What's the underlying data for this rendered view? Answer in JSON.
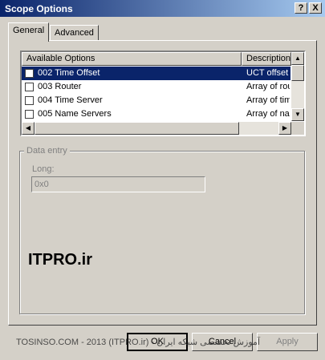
{
  "window": {
    "title": "Scope Options",
    "help_label": "?",
    "close_label": "X"
  },
  "tabs": [
    {
      "label": "General",
      "active": true
    },
    {
      "label": "Advanced",
      "active": false
    }
  ],
  "list": {
    "columns": [
      "Available Options",
      "Description"
    ],
    "rows": [
      {
        "name": "002 Time Offset",
        "desc": "UCT offset in",
        "selected": true
      },
      {
        "name": "003 Router",
        "desc": "Array of rout",
        "selected": false
      },
      {
        "name": "004 Time Server",
        "desc": "Array of time",
        "selected": false
      },
      {
        "name": "005 Name Servers",
        "desc": "Array of nam",
        "selected": false
      }
    ]
  },
  "data_entry": {
    "group_label": "Data entry",
    "long_label": "Long:",
    "long_value": "0x0"
  },
  "watermark": "ITPRO.ir",
  "footer_text": "TOSINSO.COM - 2013 (ITPRO.ir) - آموزش تخصصی شبکه ایران",
  "buttons": {
    "ok": "OK",
    "cancel": "Cancel",
    "apply": "Apply"
  },
  "colors": {
    "selection": "#0a246a",
    "face": "#d4d0c8"
  }
}
